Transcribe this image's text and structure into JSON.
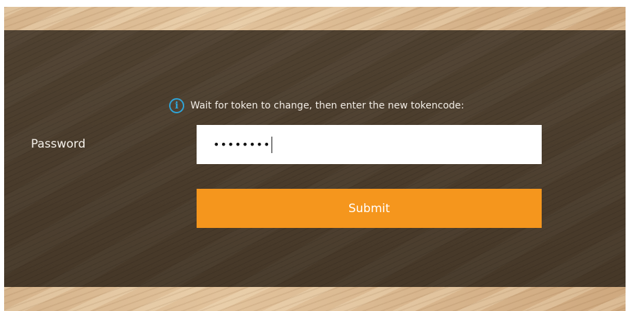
{
  "login": {
    "info_message": "Wait for token to change, then enter the new tokencode:",
    "info_icon": "info-icon",
    "password_label": "Password",
    "password_masked": "••••••••",
    "submit_label": "Submit"
  },
  "colors": {
    "accent": "#f5961d",
    "info_icon": "#2fa4d8",
    "panel": "#4a3c2c"
  }
}
